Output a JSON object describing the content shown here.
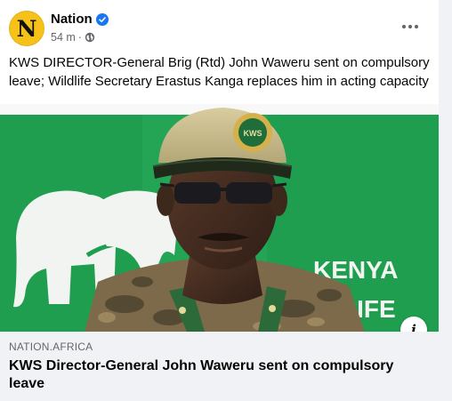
{
  "post": {
    "page_name": "Nation",
    "avatar_letter": "N",
    "verified_icon": "verified-badge-icon",
    "time": "54 m",
    "separator": "·",
    "audience_icon": "globe-icon",
    "more_icon": "more-horizontal-icon",
    "caption": "KWS DIRECTOR-General Brig (Rtd) John Waweru sent on compulsory leave; Wildlife Secretary Erastus Kanga replaces him in acting capacity"
  },
  "image": {
    "sign_text_line1": "KENYA",
    "sign_text_line2": "LIFE",
    "cap_badge_text": "KWS",
    "info_icon": "info-icon",
    "info_label": "i"
  },
  "link_preview": {
    "domain": "NATION.AFRICA",
    "title": "KWS Director-General John Waweru sent on compulsory leave"
  },
  "colors": {
    "accent": "#1877f2",
    "avatar": "#f6c21a",
    "kws_green": "#1f9e4f"
  }
}
